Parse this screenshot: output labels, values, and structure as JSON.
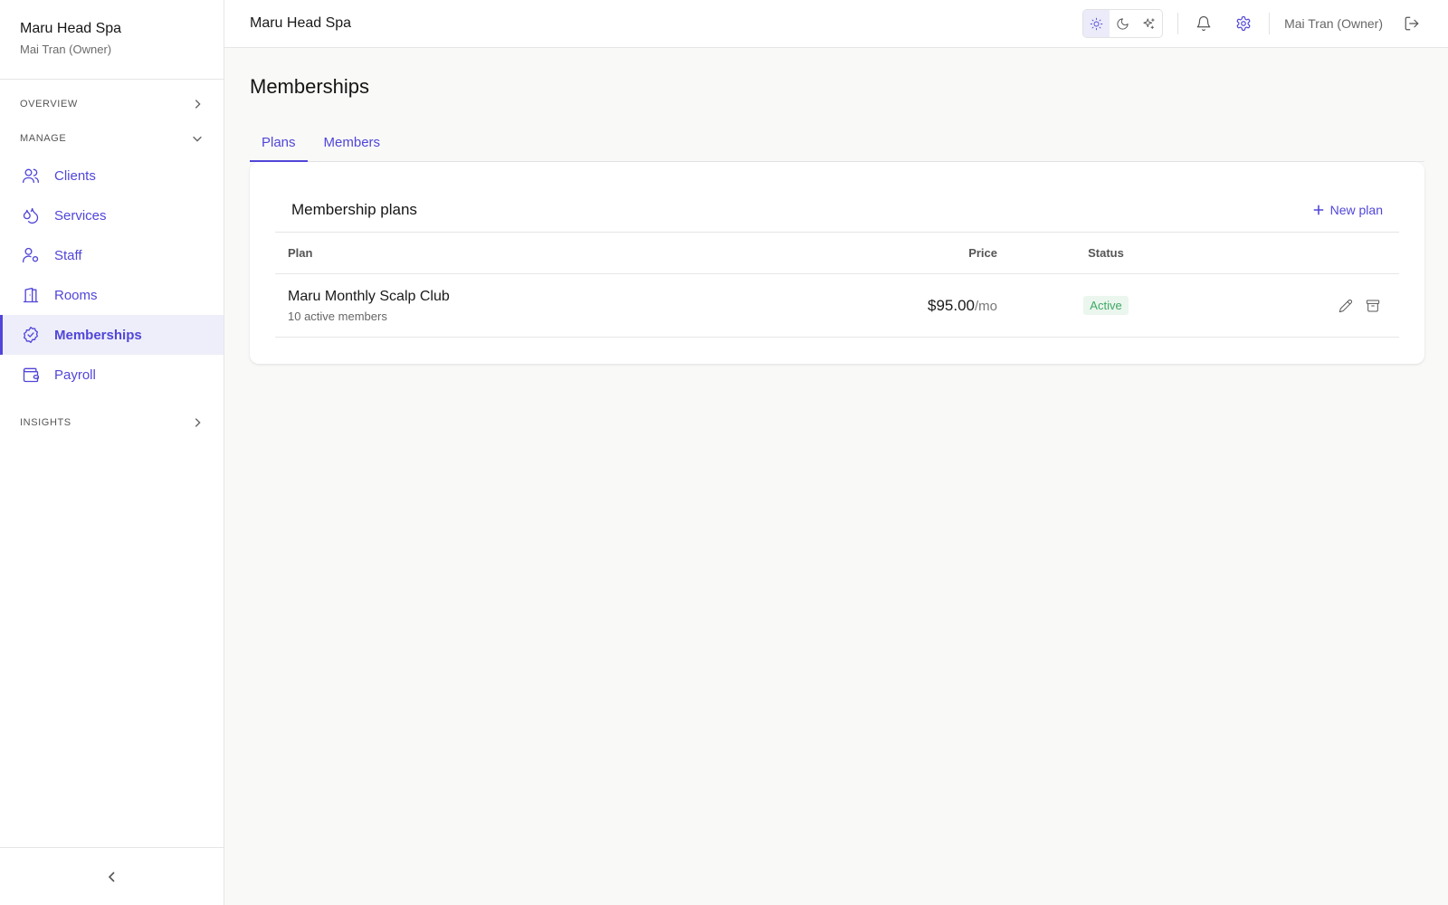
{
  "sidebar": {
    "brand_name": "Maru Head Spa",
    "brand_sub": "Mai Tran (Owner)",
    "overview_label": "OVERVIEW",
    "manage_label": "MANAGE",
    "insights_label": "INSIGHTS",
    "items": [
      {
        "label": "Clients",
        "icon": "users-icon"
      },
      {
        "label": "Services",
        "icon": "droplets-icon"
      },
      {
        "label": "Staff",
        "icon": "user-cog-icon"
      },
      {
        "label": "Rooms",
        "icon": "door-icon"
      },
      {
        "label": "Memberships",
        "icon": "badge-check-icon",
        "active": true
      },
      {
        "label": "Payroll",
        "icon": "wallet-icon"
      }
    ]
  },
  "topbar": {
    "title": "Maru Head Spa",
    "user_label": "Mai Tran (Owner)",
    "theme_options": [
      "light",
      "dark",
      "auto"
    ],
    "theme_selected": "light"
  },
  "main": {
    "page_title": "Memberships",
    "tabs": [
      {
        "label": "Plans",
        "active": true
      },
      {
        "label": "Members",
        "active": false
      }
    ],
    "card": {
      "title": "Membership plans",
      "new_button": "New plan",
      "columns": {
        "plan": "Plan",
        "price": "Price",
        "status": "Status"
      },
      "rows": [
        {
          "name": "Maru Monthly Scalp Club",
          "sub": "10 active members",
          "price": "$95.00",
          "price_unit": "/mo",
          "status": "Active"
        }
      ]
    }
  },
  "colors": {
    "accent": "#5146d8",
    "active_bg": "#eeeefb",
    "status_active_bg": "#eaf6ee",
    "status_active_text": "#3fa865"
  }
}
